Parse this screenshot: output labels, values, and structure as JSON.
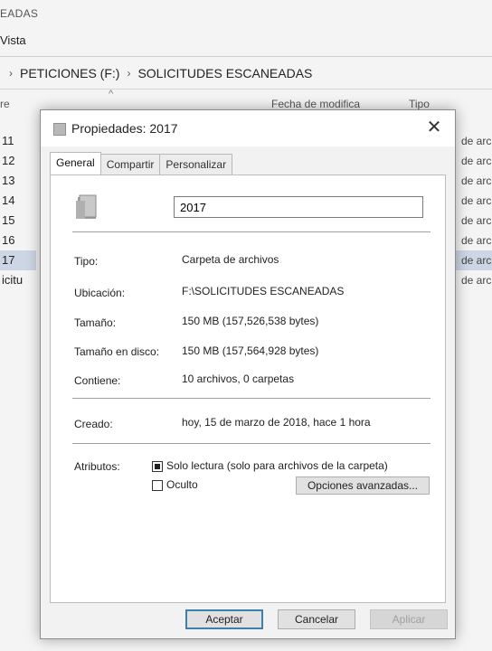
{
  "explorer": {
    "title_fragment": "EADAS",
    "menu_fragment": "Vista",
    "breadcrumb": [
      "PETICIONES (F:)",
      "SOLICITUDES ESCANEADAS"
    ],
    "col_name_fragment": "re",
    "col_date": "Fecha de modifica",
    "col_type": "Tipo",
    "left_rows": [
      "11",
      "12",
      "13",
      "14",
      "15",
      "16",
      "17",
      "icitu"
    ],
    "right_rows": [
      "de arc",
      "de arc",
      "de arc",
      "de arc",
      "de arc",
      "de arc",
      "de arc",
      "de arc"
    ]
  },
  "dialog": {
    "title": "Propiedades: 2017",
    "close": "✕",
    "tabs": [
      "General",
      "Compartir",
      "Personalizar"
    ],
    "name_value": "2017",
    "props": {
      "tipo_label": "Tipo:",
      "tipo_value": "Carpeta de archivos",
      "ubicacion_label": "Ubicación:",
      "ubicacion_value": "F:\\SOLICITUDES ESCANEADAS",
      "tamano_label": "Tamaño:",
      "tamano_value": "150 MB (157,526,538 bytes)",
      "disco_label": "Tamaño en disco:",
      "disco_value": "150 MB (157,564,928 bytes)",
      "contiene_label": "Contiene:",
      "contiene_value": "10 archivos, 0 carpetas",
      "creado_label": "Creado:",
      "creado_value": "hoy, 15 de marzo de 2018, hace 1 hora",
      "atributos_label": "Atributos:"
    },
    "attributes": {
      "readonly_label": "Solo lectura (solo para archivos de la carpeta)",
      "hidden_label": "Oculto",
      "advanced_button": "Opciones avanzadas..."
    },
    "buttons": {
      "ok": "Aceptar",
      "cancel": "Cancelar",
      "apply": "Aplicar"
    }
  },
  "colors": {
    "selection": "#ccd6e4",
    "default_button_border": "#3c7fb1"
  }
}
